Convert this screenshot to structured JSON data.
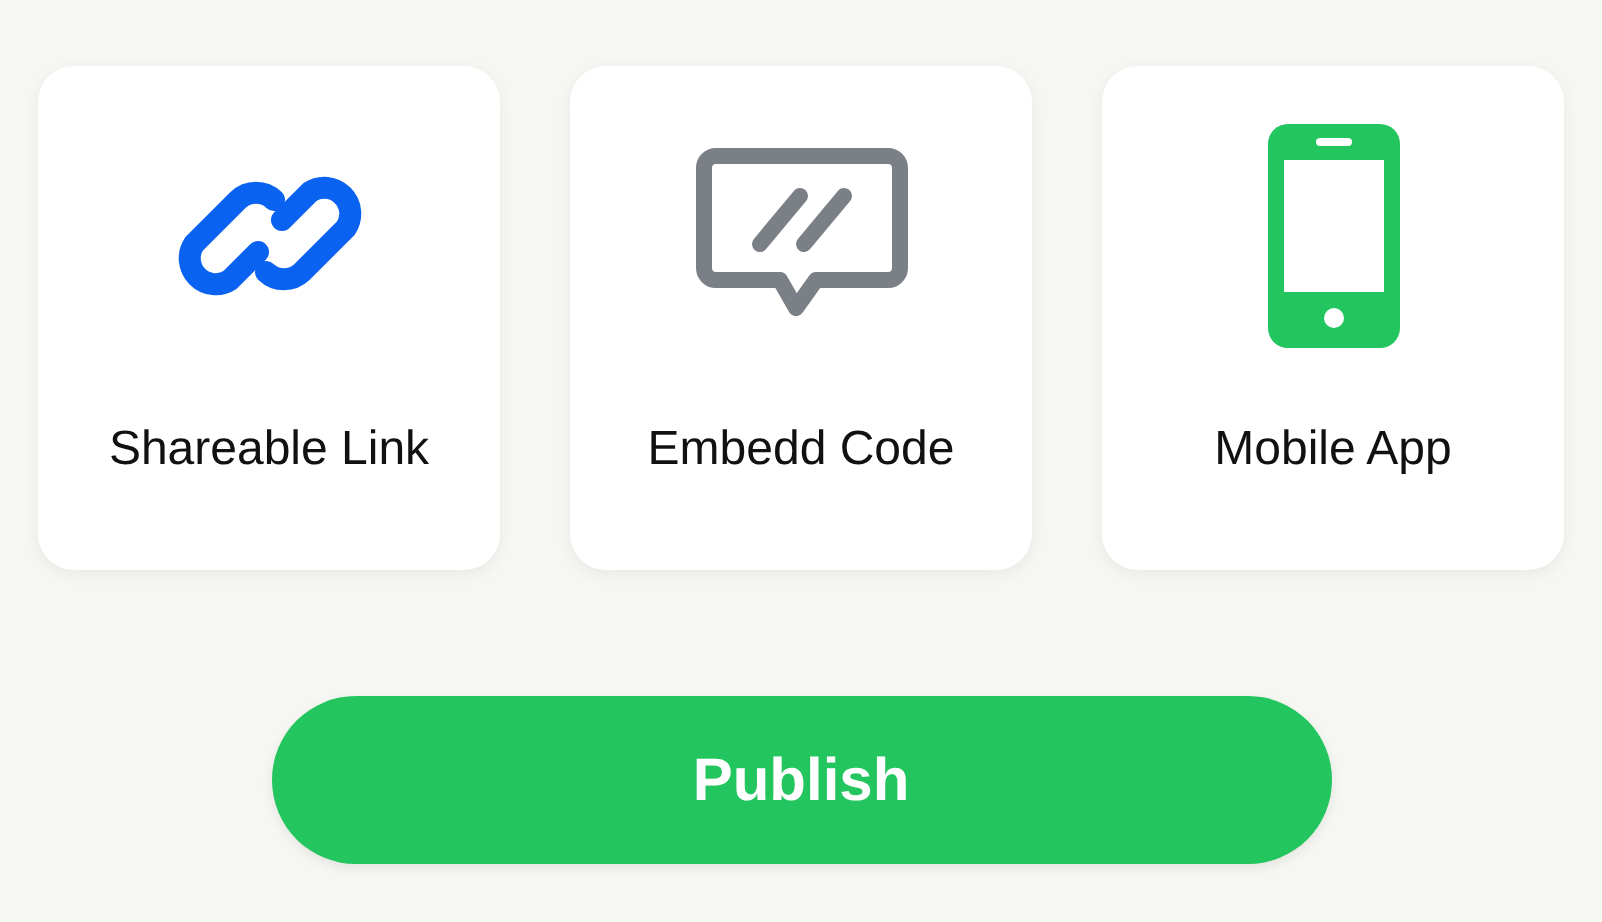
{
  "options": [
    {
      "kind": "link",
      "label": "Shareable Link"
    },
    {
      "kind": "embed",
      "label": "Embedd Code"
    },
    {
      "kind": "mobile",
      "label": "Mobile App"
    }
  ],
  "publish_button": {
    "label": "Publish"
  }
}
